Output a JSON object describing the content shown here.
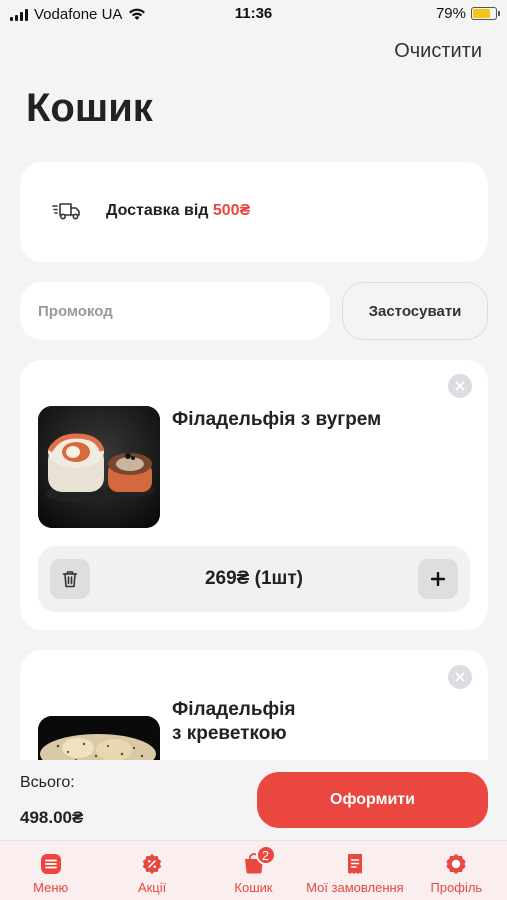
{
  "status_bar": {
    "carrier": "Vodafone UA",
    "time": "11:36",
    "battery": "79%",
    "battery_level": 0.79
  },
  "header": {
    "clear_label": "Очистити",
    "title": "Кошик"
  },
  "delivery": {
    "text": "Доставка від",
    "amount": "500₴",
    "icon": "truck-icon"
  },
  "promo": {
    "placeholder": "Промокод",
    "apply_label": "Застосувати"
  },
  "items": [
    {
      "name": "Філадельфія з вугрем",
      "price": "269₴",
      "quantity": "(1шт)"
    },
    {
      "name_line1": "Філадельфія",
      "name_line2": "з креветкою"
    }
  ],
  "summary": {
    "total_label": "Всього:",
    "total_value": "498.00₴",
    "checkout_label": "Оформити"
  },
  "tabs": [
    {
      "label": "Меню",
      "icon": "menu-icon"
    },
    {
      "label": "Акції",
      "icon": "discount-icon"
    },
    {
      "label": "Кошик",
      "icon": "cart-icon",
      "badge": "2"
    },
    {
      "label": "Мої замовлення",
      "icon": "receipt-icon"
    },
    {
      "label": "Профіль",
      "icon": "profile-icon"
    }
  ],
  "colors": {
    "accent": "#e94740",
    "background": "#f4f4f4",
    "tab_bar": "#fbeeee"
  }
}
